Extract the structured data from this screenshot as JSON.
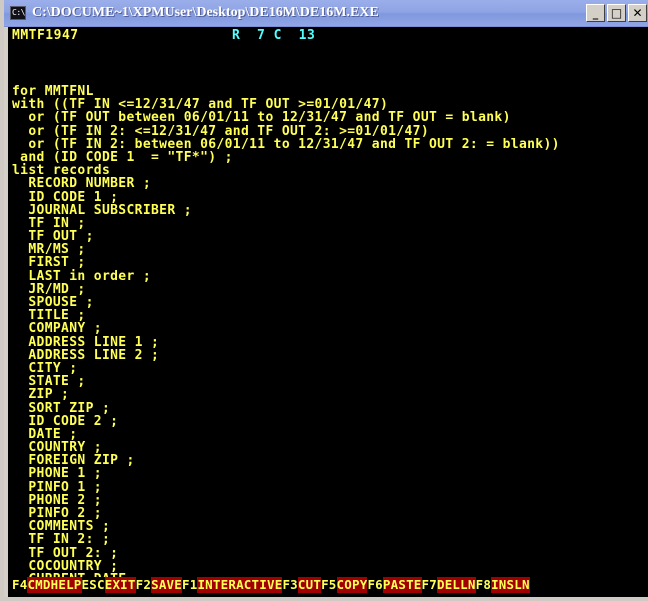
{
  "window": {
    "title": "C:\\DOCUME~1\\XPMUser\\Desktop\\DE16M\\DE16M.EXE",
    "icon": "console-cmd-icon",
    "buttons": {
      "minimize": "_",
      "maximize": "□",
      "close": "✕"
    },
    "titlebar_color": "#8fa4e4",
    "frame_color": "#d4d0c8"
  },
  "console": {
    "background": "#000000",
    "text_color": "#ffff55",
    "accent_color": "#55ffff",
    "status": {
      "file_label": "MMTF1947",
      "row_col": "R  7 C  13",
      "row_label": "R",
      "row_value": "7",
      "col_label": "C",
      "col_value": "13"
    },
    "code_lines": [
      "for MMTFNL",
      "with ((TF IN <=12/31/47 and TF OUT >=01/01/47)",
      "  or (TF OUT between 06/01/11 to 12/31/47 and TF OUT = blank)",
      "  or (TF IN 2: <=12/31/47 and TF OUT 2: >=01/01/47)",
      "  or (TF IN 2: between 06/01/11 to 12/31/47 and TF OUT 2: = blank))",
      " and (ID CODE 1  = \"TF*\") ;",
      "list records",
      "  RECORD NUMBER ;",
      "  ID CODE 1 ;",
      "  JOURNAL SUBSCRIBER ;",
      "  TF IN ;",
      "  TF OUT ;",
      "  MR/MS ;",
      "  FIRST ;",
      "  LAST in order ;",
      "  JR/MD ;",
      "  SPOUSE ;",
      "  TITLE ;",
      "  COMPANY ;",
      "  ADDRESS LINE 1 ;",
      "  ADDRESS LINE 2 ;",
      "  CITY ;",
      "  STATE ;",
      "  ZIP ;",
      "  SORT ZIP ;",
      "  ID CODE 2 ;",
      "  DATE ;",
      "  COUNTRY ;",
      "  FOREIGN ZIP ;",
      "  PHONE 1 ;",
      "  PINFO 1 ;",
      "  PHONE 2 ;",
      "  PINFO 2 ;",
      "  COMMENTS ;",
      "  TF IN 2: ;",
      "  TF OUT 2: ;",
      "  COCOUNTRY ;",
      "  CURRENT DATE ."
    ]
  },
  "fkeys": {
    "key_color": "#ffff55",
    "action_bg": "#a00000",
    "items": [
      {
        "key": "F4",
        "action": "CMDHELP"
      },
      {
        "key": "ESC",
        "action": "EXIT"
      },
      {
        "key": "F2",
        "action": "SAVE"
      },
      {
        "key": "F1",
        "action": "INTERACTIVE"
      },
      {
        "key": "F3",
        "action": "CUT"
      },
      {
        "key": "F5",
        "action": "COPY"
      },
      {
        "key": "F6",
        "action": "PASTE"
      },
      {
        "key": "F7",
        "action": "DELLN"
      },
      {
        "key": "F8",
        "action": "INSLN"
      }
    ]
  }
}
